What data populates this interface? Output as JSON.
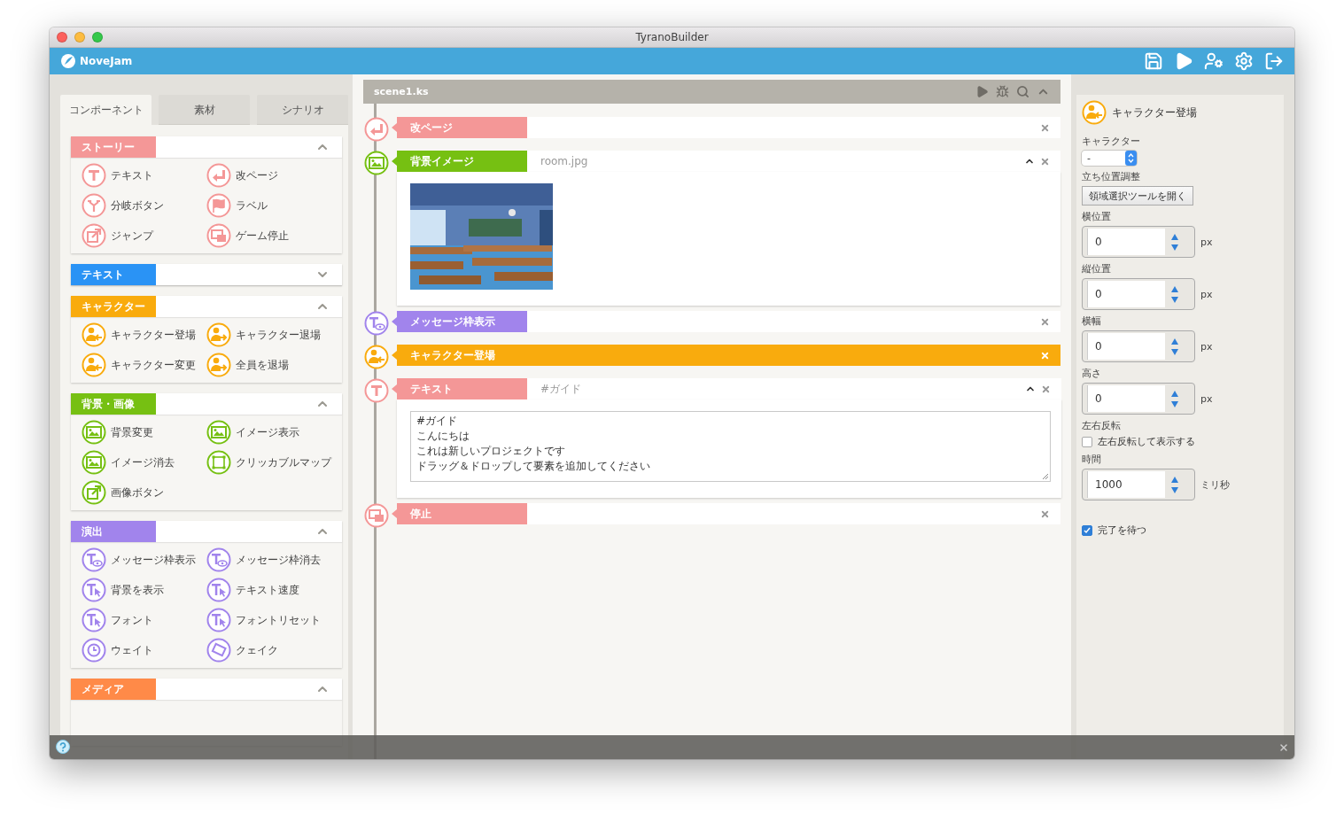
{
  "window": {
    "title": "TyranoBuilder"
  },
  "app_bar": {
    "brand": "NoveJam"
  },
  "left_tabs": [
    {
      "label": "コンポーネント",
      "selected": true
    },
    {
      "label": "素材",
      "selected": false
    },
    {
      "label": "シナリオ",
      "selected": false
    }
  ],
  "sections": [
    {
      "title": "ストーリー",
      "color": "#f49797",
      "expanded": true,
      "items": [
        "テキスト",
        "改ページ",
        "分岐ボタン",
        "ラベル",
        "ジャンプ",
        "ゲーム停止"
      ]
    },
    {
      "title": "テキスト",
      "color": "#2a93f5",
      "expanded": false
    },
    {
      "title": "キャラクター",
      "color": "#f9ab0d",
      "expanded": true,
      "items": [
        "キャラクター登場",
        "キャラクター退場",
        "キャラクター変更",
        "全員を退場"
      ]
    },
    {
      "title": "背景・画像",
      "color": "#76c012",
      "expanded": true,
      "items": [
        "背景変更",
        "イメージ表示",
        "イメージ消去",
        "クリッカブルマップ",
        "画像ボタン"
      ]
    },
    {
      "title": "演出",
      "color": "#a184ec",
      "expanded": true,
      "items": [
        "メッセージ枠表示",
        "メッセージ枠消去",
        "背景を表示",
        "テキスト速度",
        "フォント",
        "フォントリセット",
        "ウェイト",
        "クェイク"
      ]
    },
    {
      "title": "メディア",
      "color": "#ff8a48",
      "expanded": true
    }
  ],
  "scene": {
    "file": "scene1.ks",
    "rows": [
      {
        "label": "改ページ",
        "color": "#f49797",
        "selected": false,
        "expanded": false
      },
      {
        "label": "背景イメージ",
        "color": "#76c012",
        "value": "room.jpg",
        "selected": false,
        "expanded": true
      },
      {
        "label": "メッセージ枠表示",
        "color": "#a184ec",
        "selected": false,
        "expanded": false
      },
      {
        "label": "キャラクター登場",
        "color": "#f9ab0d",
        "selected": true,
        "expanded": false
      },
      {
        "label": "テキスト",
        "color": "#f49797",
        "value": "#ガイド",
        "selected": false,
        "expanded": true,
        "body": {
          "kind": "textarea",
          "lines": [
            "#ガイド",
            "こんにちは",
            "これは新しいプロジェクトです",
            "ドラッグ＆ドロップして要素を追加してください"
          ]
        }
      },
      {
        "label": "停止",
        "color": "#f49797",
        "selected": false,
        "expanded": false
      }
    ]
  },
  "inspector": {
    "title": "キャラクター登場",
    "color": "#f9ab0d",
    "fields": [
      {
        "kind": "select",
        "label": "キャラクター",
        "value": "-"
      },
      {
        "kind": "button",
        "label": "立ち位置調整",
        "text": "領域選択ツールを開く"
      },
      {
        "kind": "number",
        "label": "横位置",
        "value": "0",
        "unit": "px"
      },
      {
        "kind": "number",
        "label": "縦位置",
        "value": "0",
        "unit": "px"
      },
      {
        "kind": "number",
        "label": "横幅",
        "value": "0",
        "unit": "px"
      },
      {
        "kind": "number",
        "label": "高さ",
        "value": "0",
        "unit": "px"
      },
      {
        "kind": "checkbox",
        "label": "左右反転",
        "text": "左右反転して表示する",
        "checked": false
      },
      {
        "kind": "number",
        "label": "時間",
        "value": "1000",
        "unit": "ミリ秒"
      },
      {
        "kind": "checkbox",
        "text": "完了を待つ",
        "checked": true
      }
    ]
  }
}
